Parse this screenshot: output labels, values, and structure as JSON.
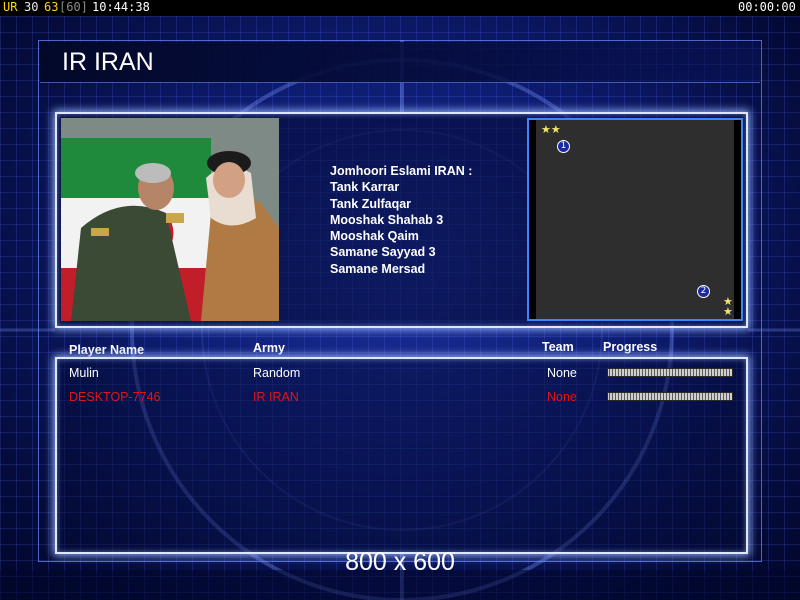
{
  "topbar": {
    "ur_label": "UR",
    "ur_value": "30",
    "fps": "63",
    "fps_limit": "[60]",
    "clock": "10:44:38",
    "timer": "00:00:00"
  },
  "header": {
    "title": "IR IRAN"
  },
  "army_info": {
    "heading": "Jomhoori Eslami IRAN :",
    "units": [
      "Tank Karrar",
      "Tank Zulfaqar",
      "Mooshak Shahab 3",
      "Mooshak Qaim",
      "Samane Sayyad 3",
      "Samane Mersad"
    ]
  },
  "minimap": {
    "slots": [
      "1",
      "2"
    ],
    "star_icon": "star-icon"
  },
  "players": {
    "headers": {
      "name": "Player Name",
      "army": "Army",
      "team": "Team",
      "progress": "Progress"
    },
    "rows": [
      {
        "name": "Mulin",
        "army": "Random",
        "team": "None",
        "progress": 0,
        "color": "#ffffff"
      },
      {
        "name": "DESKTOP-7746",
        "army": "IR IRAN",
        "team": "None",
        "progress": 0,
        "color": "#e01616"
      }
    ]
  },
  "footer": {
    "resolution": "800 x 600"
  },
  "colors": {
    "accent": "#3a86ff",
    "local_player": "#e01616",
    "fps": "#ffd21c"
  }
}
